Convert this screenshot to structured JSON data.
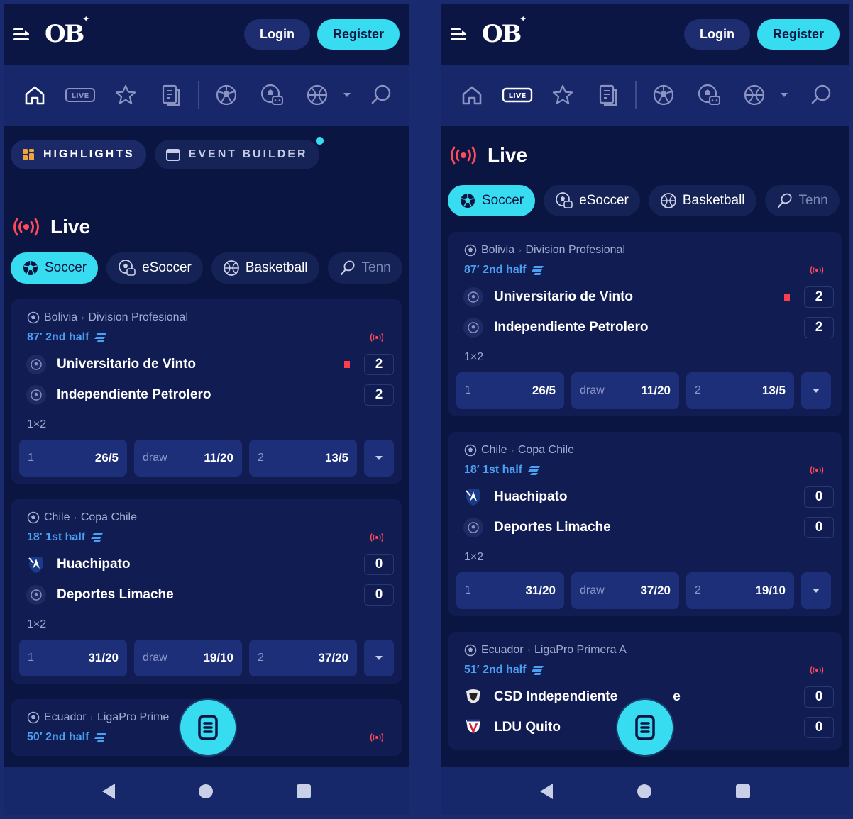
{
  "header": {
    "logo_text": "OB",
    "login_label": "Login",
    "register_label": "Register"
  },
  "nav_icons": [
    "home-icon",
    "live-icon",
    "favorites-star-icon",
    "betslip-icon",
    "soccer-ball-icon",
    "esoccer-icon",
    "basketball-icon",
    "chevron-down-icon",
    "search-icon"
  ],
  "nav": {
    "live_label": "LIVE"
  },
  "top_tabs": {
    "highlights": "HIGHLIGHTS",
    "event_builder": "EVENT BUILDER"
  },
  "live_section": {
    "title": "Live"
  },
  "sports": [
    "Soccer",
    "eSoccer",
    "Basketball",
    "Tenn"
  ],
  "separator": "›",
  "matches": [
    {
      "country": "Bolivia",
      "league": "Division Profesional",
      "time": "87′ 2nd half",
      "home": "Universitario de Vinto",
      "away": "Independiente Petrolero",
      "home_score": "2",
      "away_score": "2",
      "market": "1×2",
      "odds": [
        {
          "label": "1",
          "value": "26/5"
        },
        {
          "label": "draw",
          "value": "11/20"
        },
        {
          "label": "2",
          "value": "13/5"
        }
      ]
    },
    {
      "country": "Chile",
      "league": "Copa Chile",
      "time": "18′ 1st half",
      "home": "Huachipato",
      "away": "Deportes Limache",
      "home_score": "0",
      "away_score": "0",
      "market": "1×2",
      "odds_left": [
        {
          "label": "1",
          "value": "31/20"
        },
        {
          "label": "draw",
          "value": "19/10"
        },
        {
          "label": "2",
          "value": "37/20"
        }
      ],
      "odds_right": [
        {
          "label": "1",
          "value": "31/20"
        },
        {
          "label": "draw",
          "value": "37/20"
        },
        {
          "label": "2",
          "value": "19/10"
        }
      ]
    },
    {
      "country": "Ecuador",
      "league_left": "LigaPro Prime",
      "league_right": "LigaPro Primera A",
      "time_left": "50′ 2nd half",
      "time_right": "51′ 2nd half",
      "home": "CSD Independiente",
      "home_suffix": "e",
      "away": "LDU Quito",
      "home_score": "0",
      "away_score": "0"
    }
  ],
  "colors": {
    "accent": "#38dcf0",
    "background": "#0b1542",
    "card": "#111d52",
    "live_red": "#ff4a5a",
    "time_blue": "#4aa0f2"
  }
}
